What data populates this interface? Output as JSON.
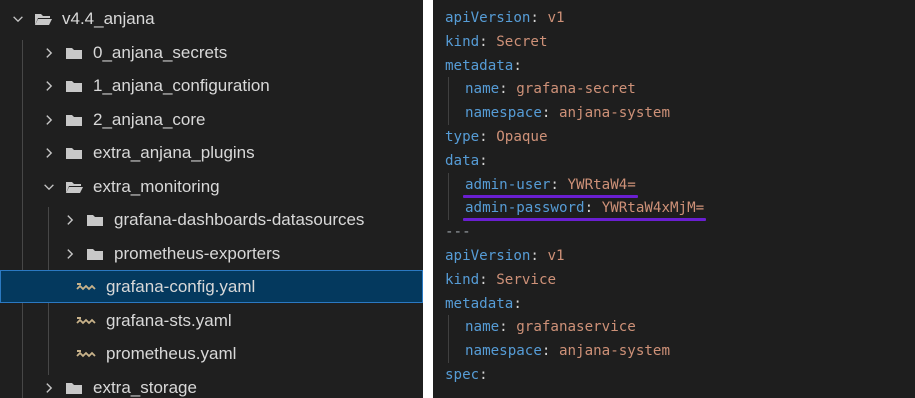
{
  "explorer": {
    "items": [
      {
        "label": "v4.4_anjana",
        "type": "folder",
        "expanded": true,
        "depth": 0
      },
      {
        "label": "0_anjana_secrets",
        "type": "folder",
        "expanded": false,
        "depth": 1
      },
      {
        "label": "1_anjana_configuration",
        "type": "folder",
        "expanded": false,
        "depth": 1
      },
      {
        "label": "2_anjana_core",
        "type": "folder",
        "expanded": false,
        "depth": 1
      },
      {
        "label": "extra_anjana_plugins",
        "type": "folder",
        "expanded": false,
        "depth": 1
      },
      {
        "label": "extra_monitoring",
        "type": "folder",
        "expanded": true,
        "depth": 1
      },
      {
        "label": "grafana-dashboards-datasources",
        "type": "folder",
        "expanded": false,
        "depth": 2
      },
      {
        "label": "prometheus-exporters",
        "type": "folder",
        "expanded": false,
        "depth": 2
      },
      {
        "label": "grafana-config.yaml",
        "type": "yaml",
        "selected": true,
        "depth": 2
      },
      {
        "label": "grafana-sts.yaml",
        "type": "yaml",
        "depth": 2
      },
      {
        "label": "prometheus.yaml",
        "type": "yaml",
        "depth": 2
      },
      {
        "label": "extra_storage",
        "type": "folder",
        "expanded": false,
        "depth": 1
      }
    ]
  },
  "editor": {
    "lines": [
      {
        "indent": 0,
        "key": "apiVersion",
        "sep": ": ",
        "value": "v1"
      },
      {
        "indent": 0,
        "key": "kind",
        "sep": ": ",
        "value": "Secret"
      },
      {
        "indent": 0,
        "key": "metadata",
        "sep": ":",
        "value": ""
      },
      {
        "indent": 1,
        "key": "name",
        "sep": ": ",
        "value": "grafana-secret"
      },
      {
        "indent": 1,
        "key": "namespace",
        "sep": ": ",
        "value": "anjana-system"
      },
      {
        "indent": 0,
        "key": "type",
        "sep": ": ",
        "value": "Opaque"
      },
      {
        "indent": 0,
        "key": "data",
        "sep": ":",
        "value": ""
      },
      {
        "indent": 1,
        "key": "admin-user",
        "sep": ": ",
        "value": "YWRtaW4=",
        "underlined": true
      },
      {
        "indent": 1,
        "key": "admin-password",
        "sep": ": ",
        "value": "YWRtaW4xMjM=",
        "underlined": true
      },
      {
        "indent": 0,
        "key": "",
        "sep": "---",
        "value": ""
      },
      {
        "indent": 0,
        "key": "apiVersion",
        "sep": ": ",
        "value": "v1"
      },
      {
        "indent": 0,
        "key": "kind",
        "sep": ": ",
        "value": "Service"
      },
      {
        "indent": 0,
        "key": "metadata",
        "sep": ":",
        "value": ""
      },
      {
        "indent": 1,
        "key": "name",
        "sep": ": ",
        "value": "grafanaservice"
      },
      {
        "indent": 1,
        "key": "namespace",
        "sep": ": ",
        "value": "anjana-system"
      },
      {
        "indent": 0,
        "key": "spec",
        "sep": ":",
        "value": ""
      }
    ],
    "highlight_color": "#6a1fd1"
  },
  "colors": {
    "key": "#569cd6",
    "value": "#ce9178",
    "folder": "#c8c8c8",
    "yaml_icon": "#c8b28a",
    "selected_row": "#04395e"
  }
}
